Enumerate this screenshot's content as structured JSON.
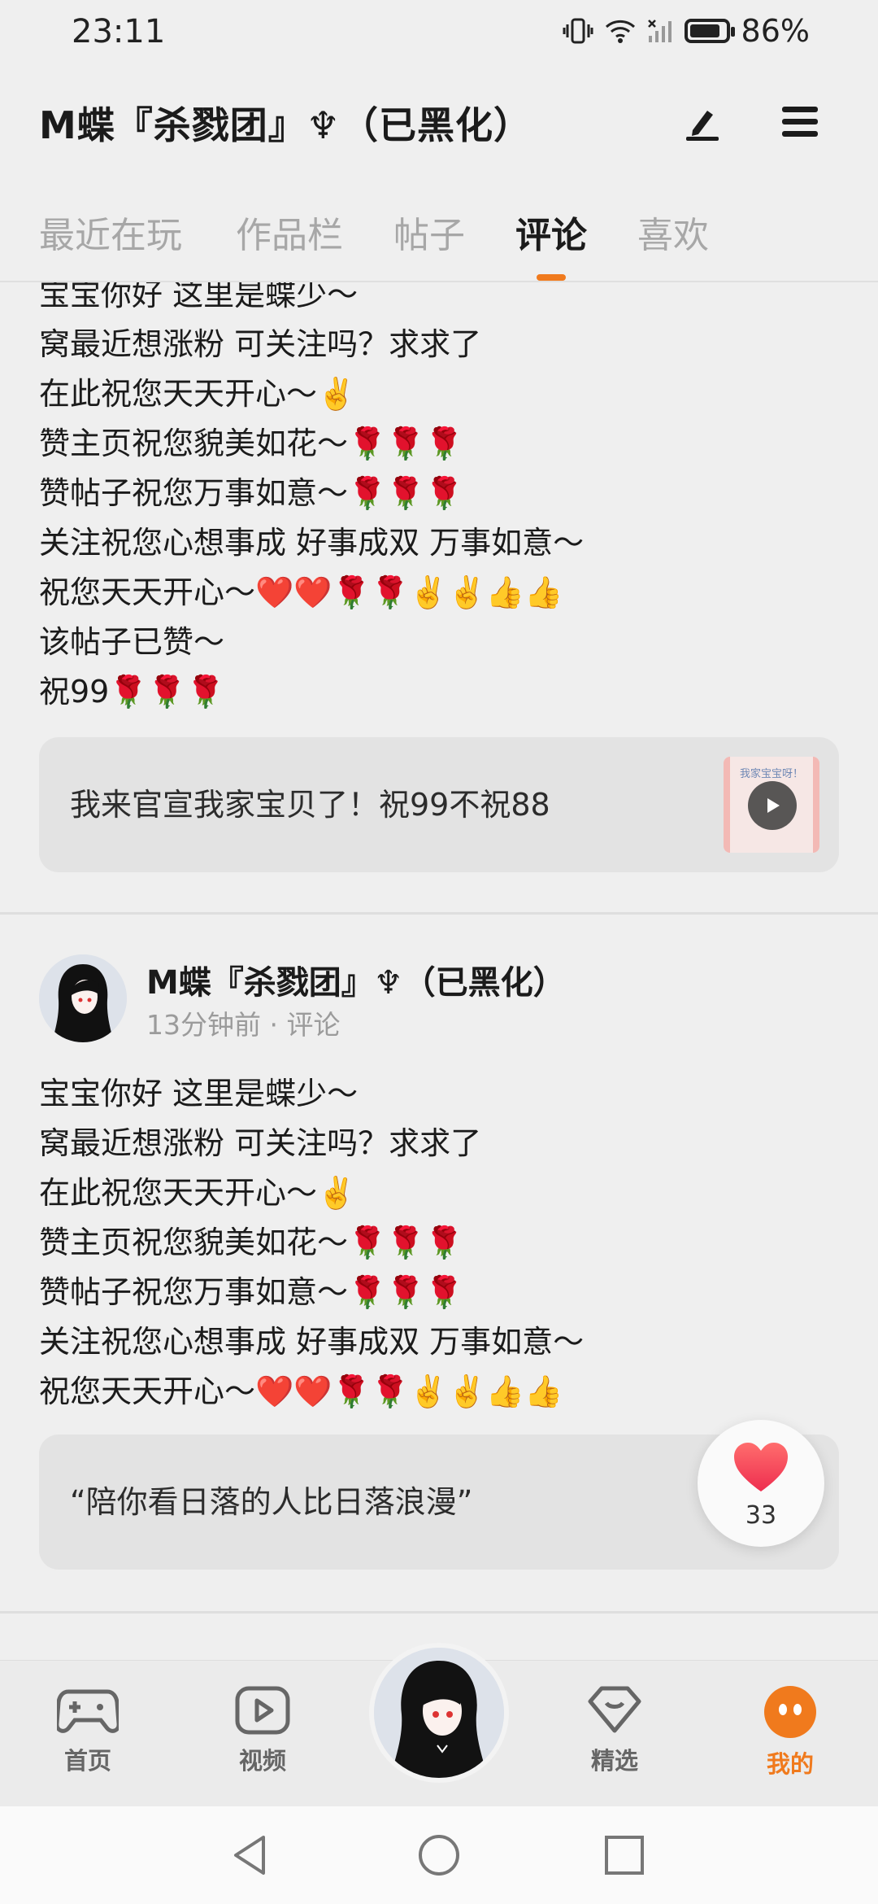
{
  "status_bar": {
    "time": "23:11",
    "battery_text": "86%",
    "battery_level": 0.86
  },
  "header": {
    "title": "M蝶『杀戮团』♆（已黑化）"
  },
  "tabs": [
    {
      "label": "最近在玩",
      "active": false
    },
    {
      "label": "作品栏",
      "active": false
    },
    {
      "label": "帖子",
      "active": false
    },
    {
      "label": "评论",
      "active": true
    },
    {
      "label": "喜欢",
      "active": false
    }
  ],
  "posts": [
    {
      "lines": [
        "宝宝你好 这里是蝶少～",
        "窝最近想涨粉 可关注吗？求求了",
        "在此祝您天天开心～✌️",
        "赞主页祝您貌美如花～🌹🌹🌹",
        "赞帖子祝您万事如意～🌹🌹🌹",
        "关注祝您心想事成 好事成双 万事如意～",
        "祝您天天开心～❤️❤️🌹🌹✌️✌️👍👍",
        "该帖子已赞～",
        "祝99🌹🌹🌹"
      ],
      "quote": "我来官宣我家宝贝了！祝99不祝88",
      "thumb_text": "我家宝宝呀！"
    },
    {
      "author": "M蝶『杀戮团』♆（已黑化）",
      "time": "13分钟前",
      "type": "评论",
      "lines": [
        "宝宝你好 这里是蝶少～",
        "窝最近想涨粉 可关注吗？求求了",
        "在此祝您天天开心～✌️",
        "赞主页祝您貌美如花～🌹🌹🌹",
        "赞帖子祝您万事如意～🌹🌹🌹",
        "关注祝您心想事成 好事成双 万事如意～",
        "祝您天天开心～❤️❤️🌹🌹✌️✌️👍👍"
      ],
      "quote": "“陪你看日落的人比日落浪漫”"
    }
  ],
  "like_button": {
    "count": "33"
  },
  "bottom_nav": [
    {
      "label": "首页",
      "icon": "gamepad-icon",
      "active": false
    },
    {
      "label": "视频",
      "icon": "video-play-icon",
      "active": false
    },
    {
      "label": "精选",
      "icon": "heart-badge-icon",
      "active": false
    },
    {
      "label": "我的",
      "icon": "face-icon",
      "active": true
    }
  ],
  "colors": {
    "accent": "#f07a1d",
    "like": "#f0474e"
  }
}
